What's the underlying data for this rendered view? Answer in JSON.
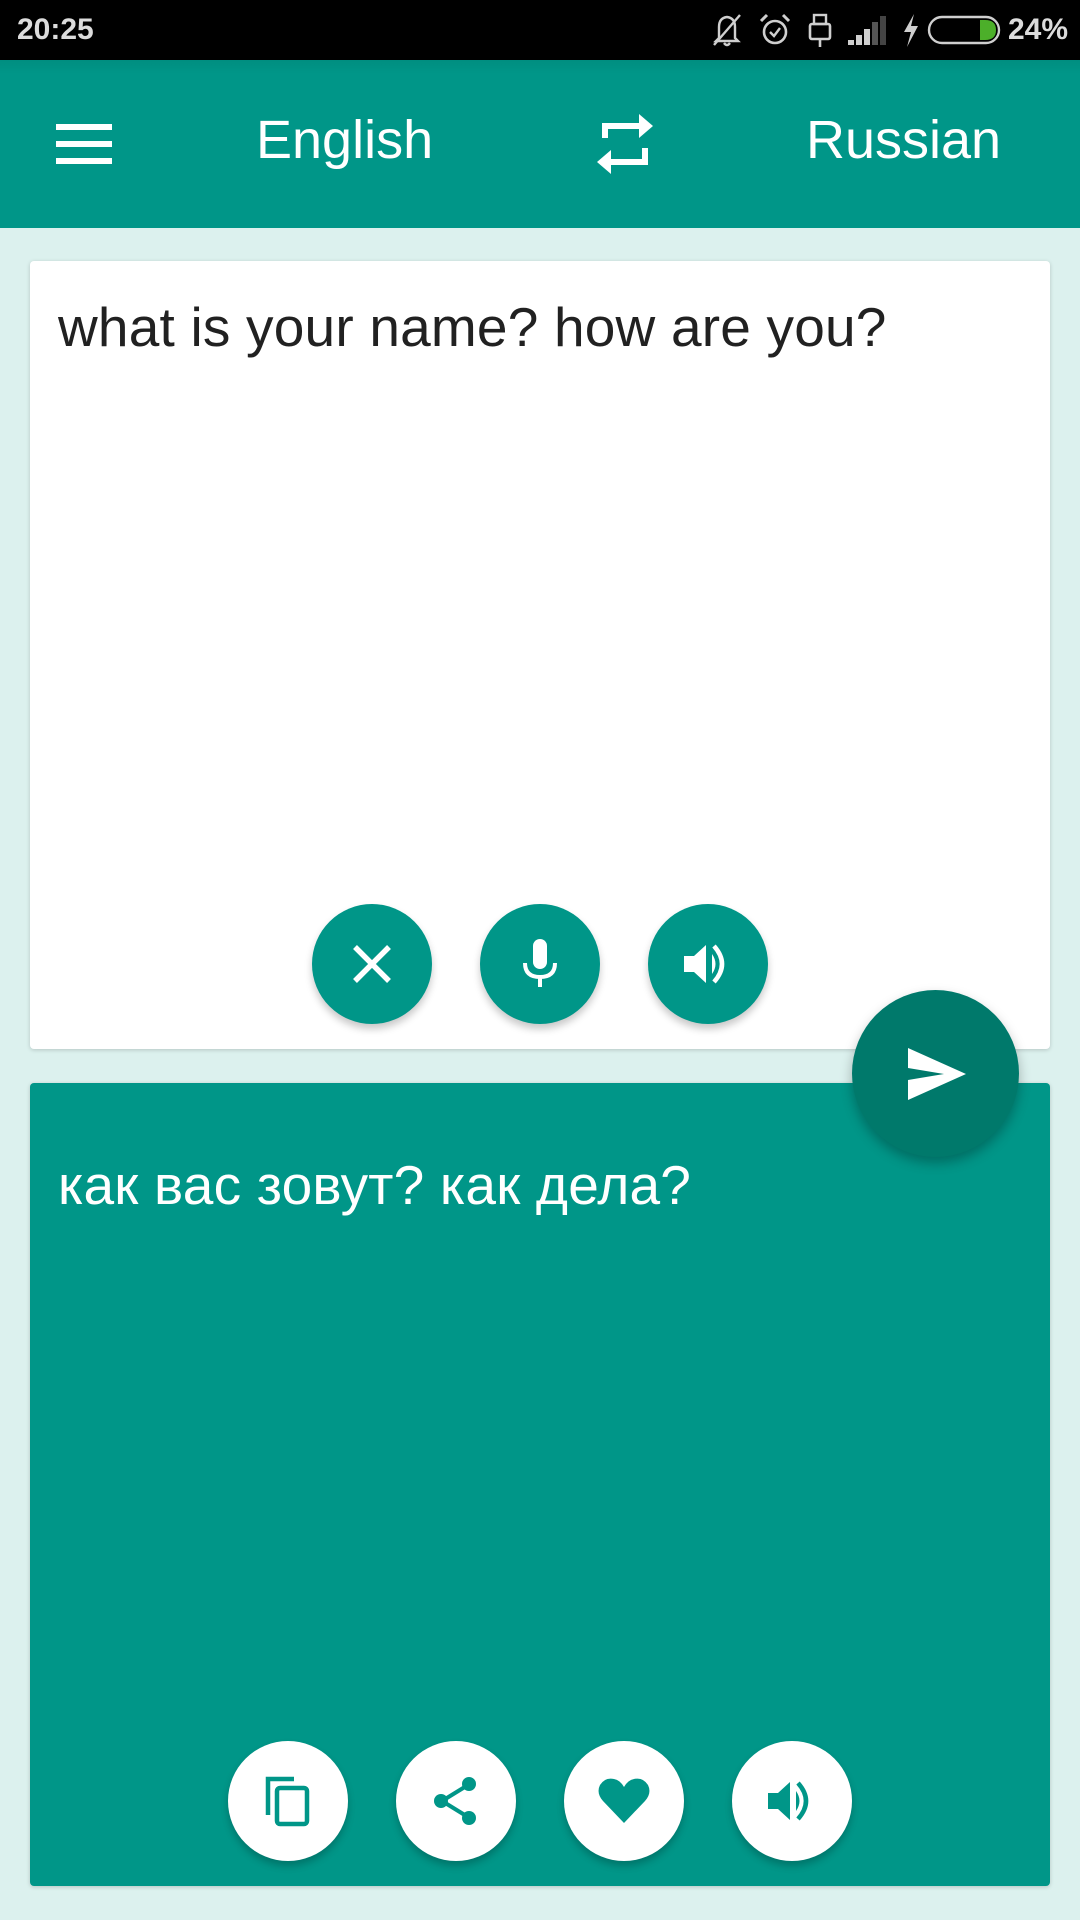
{
  "status_bar": {
    "time": "20:25",
    "battery_percent": "24%",
    "battery_level": 0.24,
    "icons": [
      "notifications-off-icon",
      "alarm-icon",
      "usb-icon",
      "signal-icon",
      "charging-bolt-icon",
      "battery-icon"
    ]
  },
  "header": {
    "menu_icon": "hamburger-menu-icon",
    "source_language": "English",
    "swap_icon": "swap-languages-icon",
    "target_language": "Russian"
  },
  "input_panel": {
    "text": "what is your name? how are you?",
    "buttons": [
      {
        "name": "clear-button",
        "icon": "close-icon"
      },
      {
        "name": "microphone-button",
        "icon": "microphone-icon"
      },
      {
        "name": "speak-source-button",
        "icon": "volume-icon"
      }
    ]
  },
  "translate_button": {
    "icon": "send-icon"
  },
  "output_panel": {
    "text": "как вас зовут? как дела?",
    "buttons": [
      {
        "name": "copy-button",
        "icon": "copy-icon"
      },
      {
        "name": "share-button",
        "icon": "share-icon"
      },
      {
        "name": "favorite-button",
        "icon": "heart-icon"
      },
      {
        "name": "speak-translation-button",
        "icon": "volume-icon"
      }
    ]
  },
  "colors": {
    "primary": "#009688",
    "primary_dark": "#00796b",
    "background": "#dcf1ee",
    "input_text": "#212121",
    "battery_fill": "#4caf2a"
  }
}
